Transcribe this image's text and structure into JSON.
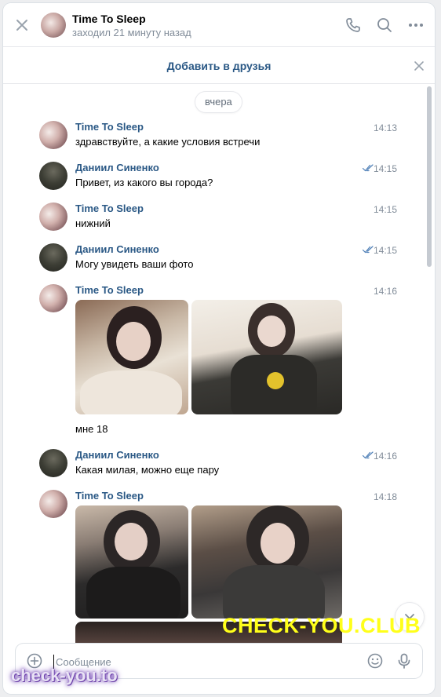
{
  "header": {
    "title": "Time To Sleep",
    "status": "заходил 21 минуту назад",
    "icons": [
      "close-icon",
      "phone-icon",
      "search-icon",
      "more-icon"
    ]
  },
  "friend_bar": {
    "add_label": "Добавить в друзья"
  },
  "date_chip": "вчера",
  "messages": [
    {
      "author": "Time To Sleep",
      "time": "14:13",
      "text": "здравствуйте, а какие условия встречи"
    },
    {
      "author": "Даниил Синенко",
      "time": "14:15",
      "text": "Привет, из какого вы города?",
      "read": true
    },
    {
      "author": "Time To Sleep",
      "time": "14:15",
      "text": "нижний"
    },
    {
      "author": "Даниил Синенко",
      "time": "14:15",
      "text": "Могу увидеть ваши фото",
      "read": true
    },
    {
      "author": "Time To Sleep",
      "time": "14:16",
      "text": "мне 18"
    },
    {
      "author": "Даниил Синенко",
      "time": "14:16",
      "text": "Какая милая, можно еще пару",
      "read": true
    },
    {
      "author": "Time To Sleep",
      "time": "14:18"
    }
  ],
  "composer": {
    "placeholder": "Сообщение"
  },
  "watermarks": {
    "top": "CHECK-YOU.CLUB",
    "bottom": "check-you.to"
  },
  "colors": {
    "link": "#2a5885",
    "muted": "#818c99",
    "background": "#edeef0",
    "watermark_yellow": "#ffff1a"
  }
}
